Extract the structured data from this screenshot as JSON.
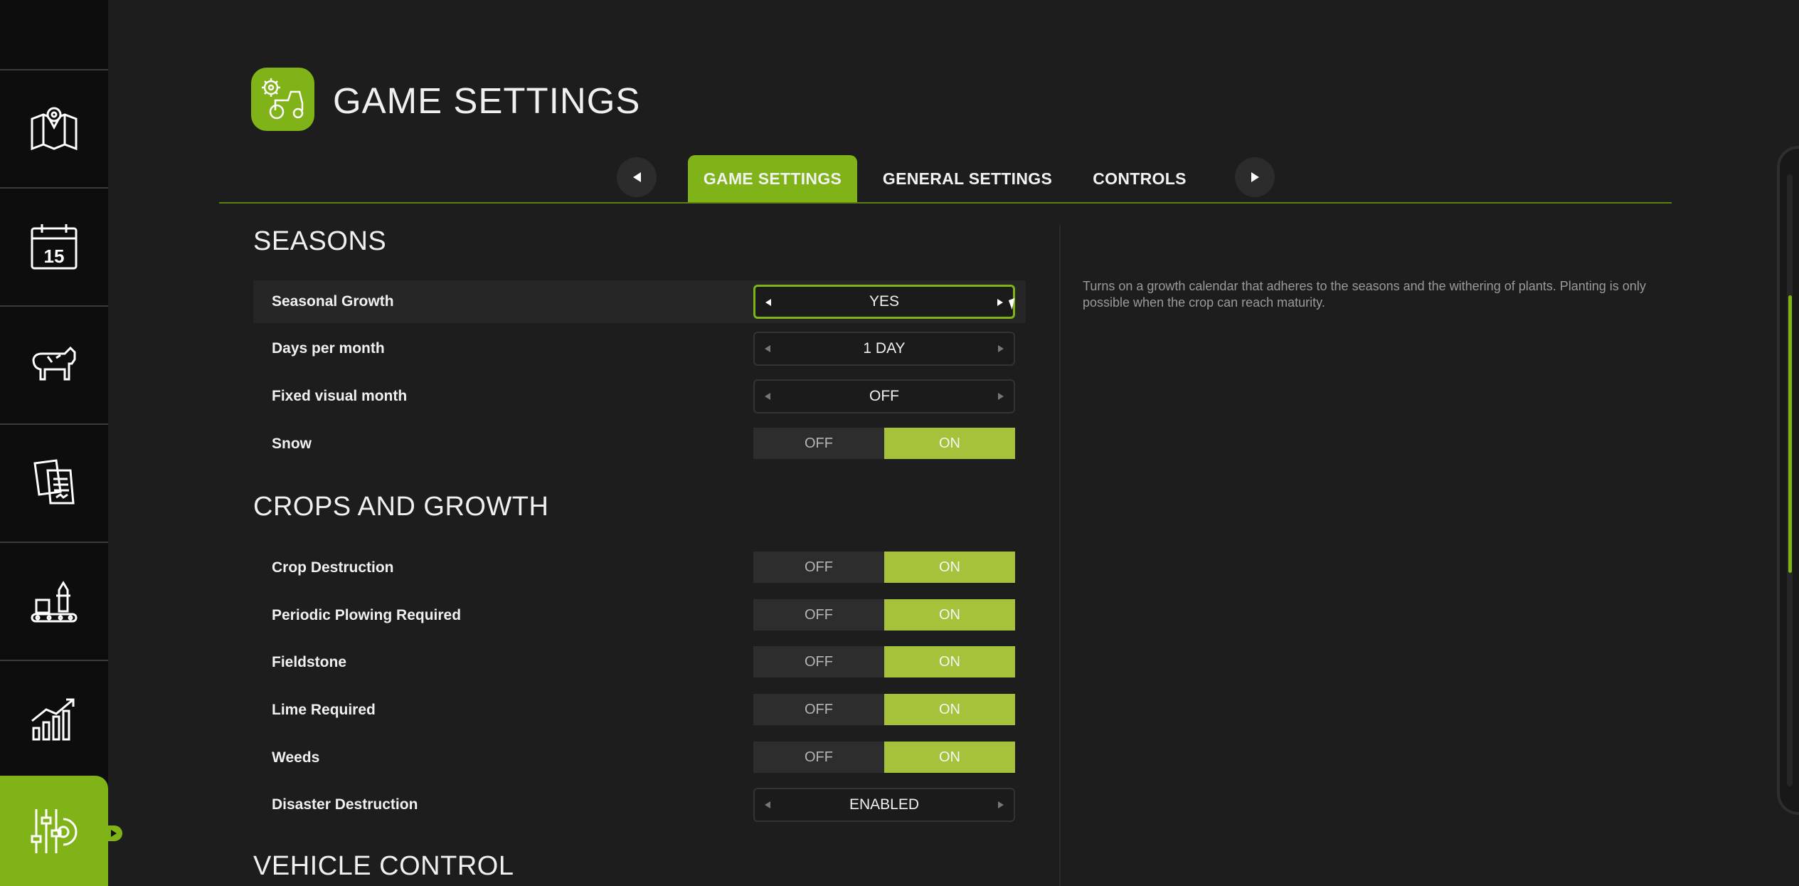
{
  "sidebar": {
    "items": [
      {
        "icon": "map-icon"
      },
      {
        "icon": "calendar-icon",
        "label": "15"
      },
      {
        "icon": "cow-icon"
      },
      {
        "icon": "contracts-icon"
      },
      {
        "icon": "production-icon"
      },
      {
        "icon": "statistics-icon"
      },
      {
        "icon": "settings-sliders-icon",
        "active": true
      }
    ]
  },
  "header": {
    "title": "GAME SETTINGS",
    "logo_icon": "tractor-gear-icon"
  },
  "tabs": [
    {
      "label": "GAME SETTINGS",
      "active": true
    },
    {
      "label": "GENERAL SETTINGS"
    },
    {
      "label": "CONTROLS"
    }
  ],
  "sections": {
    "seasons": {
      "title": "SEASONS",
      "rows": {
        "seasonal_growth": {
          "label": "Seasonal Growth",
          "value": "YES"
        },
        "days_per_month": {
          "label": "Days per month",
          "value": "1 DAY"
        },
        "fixed_visual_month": {
          "label": "Fixed visual month",
          "value": "OFF"
        },
        "snow": {
          "label": "Snow",
          "off": "OFF",
          "on": "ON",
          "selected": "ON"
        }
      }
    },
    "crops": {
      "title": "CROPS AND GROWTH",
      "rows": {
        "crop_destruction": {
          "label": "Crop Destruction",
          "off": "OFF",
          "on": "ON",
          "selected": "ON"
        },
        "periodic_plowing": {
          "label": "Periodic Plowing Required",
          "off": "OFF",
          "on": "ON",
          "selected": "ON"
        },
        "fieldstone": {
          "label": "Fieldstone",
          "off": "OFF",
          "on": "ON",
          "selected": "ON"
        },
        "lime_required": {
          "label": "Lime Required",
          "off": "OFF",
          "on": "ON",
          "selected": "ON"
        },
        "weeds": {
          "label": "Weeds",
          "off": "OFF",
          "on": "ON",
          "selected": "ON"
        },
        "disaster_destruction": {
          "label": "Disaster Destruction",
          "value": "ENABLED"
        }
      }
    },
    "vehicle": {
      "title": "VEHICLE CONTROL"
    }
  },
  "description": "Turns on a growth calendar that adheres to the seasons and the withering of plants. Planting is only possible when the crop can reach maturity.",
  "colors": {
    "accent": "#7fb317",
    "toggle_on": "#a6c13a",
    "background": "#1d1d1d",
    "sidebar": "#0d0d0d"
  }
}
